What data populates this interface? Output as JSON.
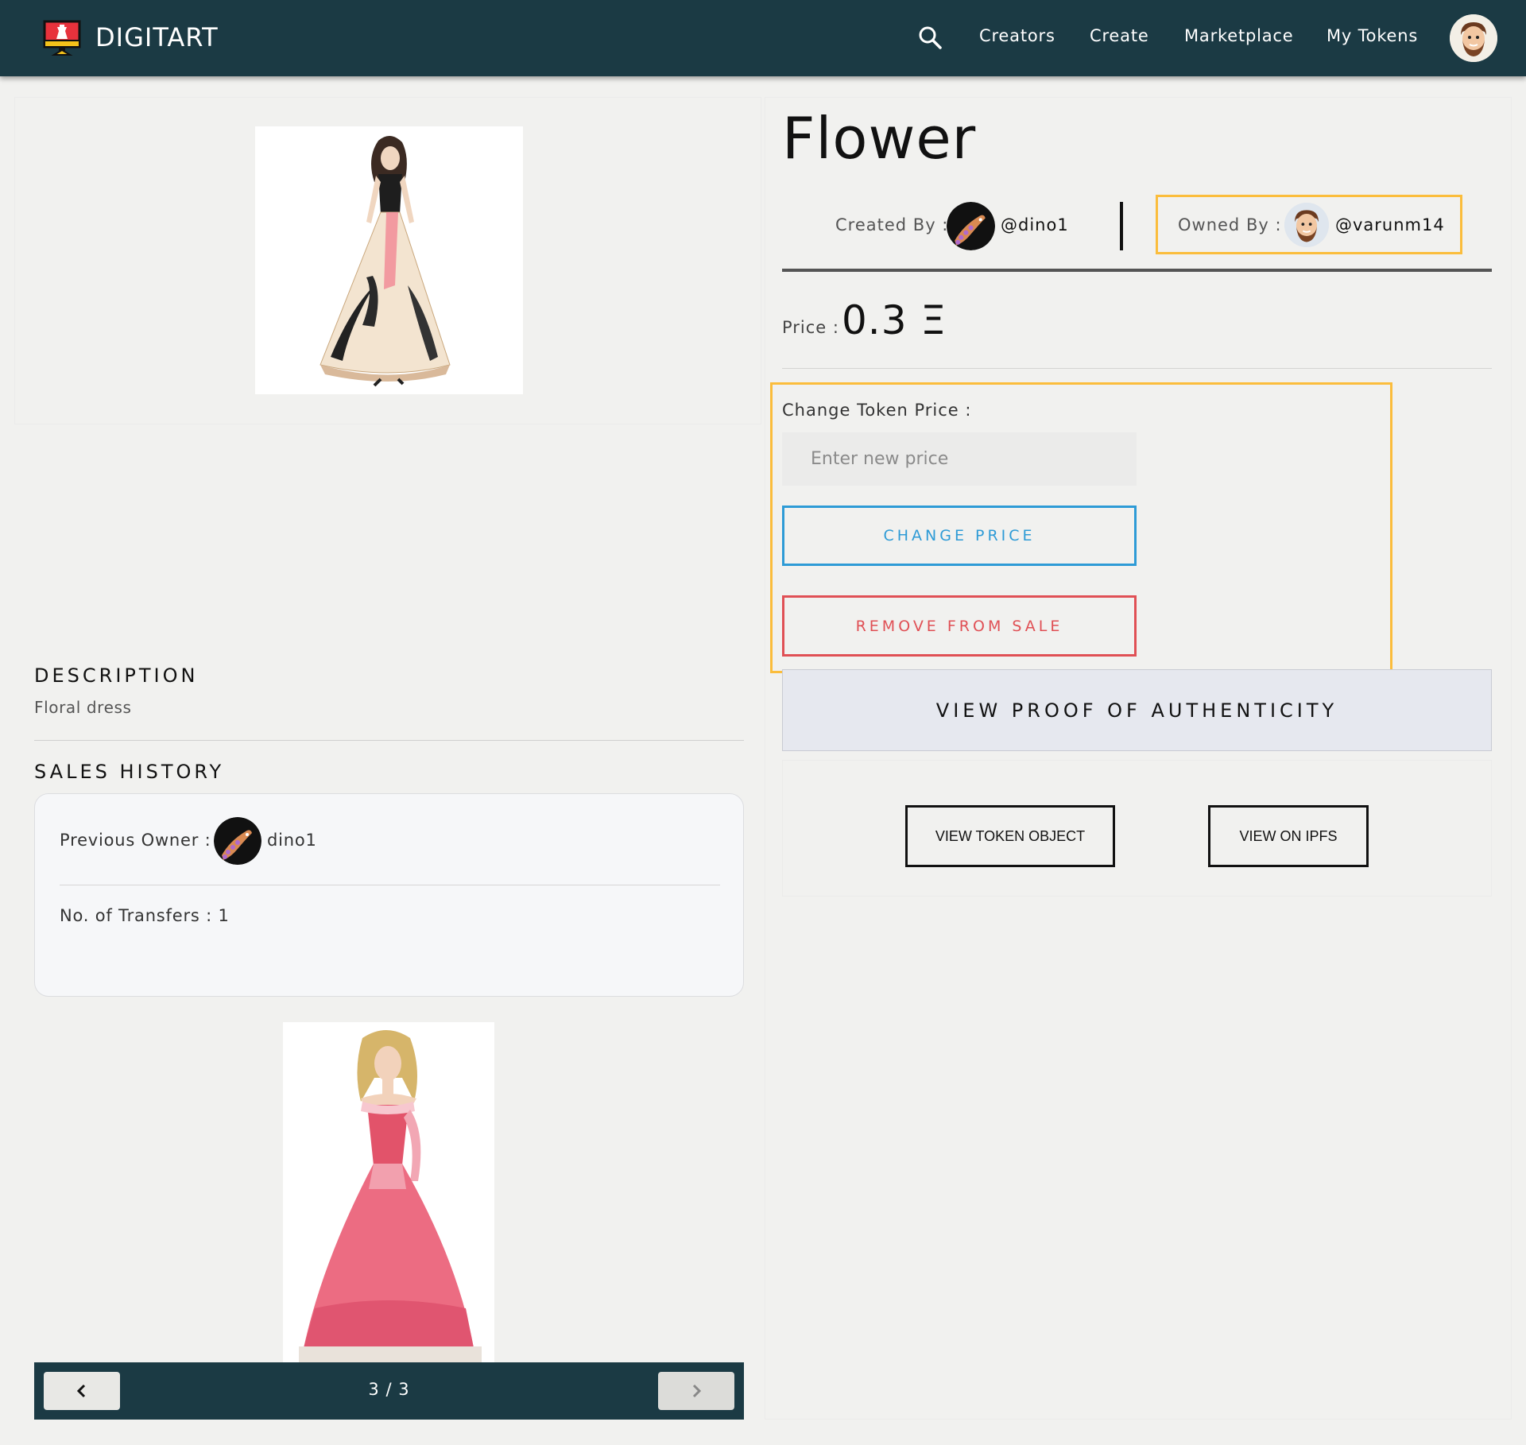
{
  "nav": {
    "brand": "DIGITART",
    "links": [
      "Creators",
      "Create",
      "Marketplace",
      "My Tokens"
    ]
  },
  "token": {
    "title": "Flower",
    "created_by_label": "Created By :",
    "creator": "@dino1",
    "owned_by_label": "Owned By :",
    "owner": "@varunm14",
    "price_label": "Price :",
    "price": "0.3 Ξ"
  },
  "change_price": {
    "label": "Change Token Price :",
    "placeholder": "Enter new price",
    "change_button": "CHANGE PRICE",
    "remove_button": "REMOVE FROM SALE"
  },
  "proof_button": "VIEW PROOF OF AUTHENTICITY",
  "view_token_button": "VIEW TOKEN OBJECT",
  "view_ipfs_button": "VIEW ON IPFS",
  "description": {
    "title": "DESCRIPTION",
    "text": "Floral dress"
  },
  "sales_history": {
    "title": "SALES HISTORY",
    "previous_owner_label": "Previous Owner :",
    "previous_owner": "dino1",
    "transfers": "No. of Transfers : 1"
  },
  "carousel": {
    "counter": "3 / 3"
  },
  "colors": {
    "navbar": "#1b3a44",
    "highlight": "#fbbd3c",
    "change_blue": "#2e9bd6",
    "remove_red": "#e05055"
  }
}
